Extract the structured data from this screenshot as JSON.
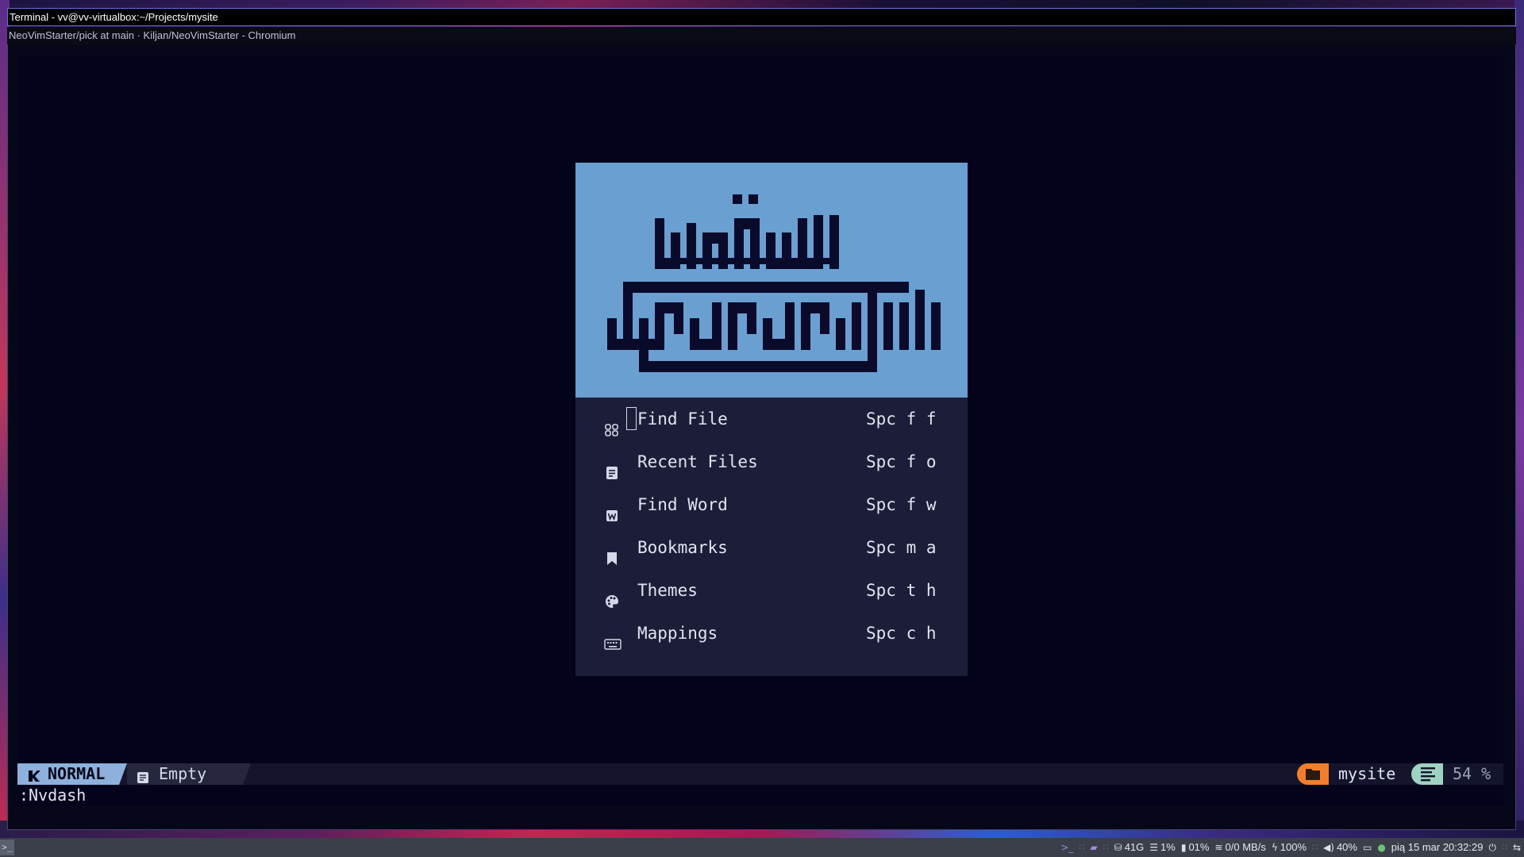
{
  "window": {
    "title": "Terminal - vv@vv-virtualbox:~/Projects/mysite",
    "behind_title": "NeoVimStarter/pick at main · Kiljan/NeoVimStarter - Chromium"
  },
  "dashboard": {
    "items": [
      {
        "icon": "find-file-icon",
        "label": "Find File",
        "key": "Spc f f"
      },
      {
        "icon": "recent-files-icon",
        "label": "Recent Files",
        "key": "Spc f o"
      },
      {
        "icon": "find-word-icon",
        "label": "Find Word",
        "key": "Spc f w"
      },
      {
        "icon": "bookmark-icon",
        "label": "Bookmarks",
        "key": "Spc m a"
      },
      {
        "icon": "palette-icon",
        "label": "Themes",
        "key": "Spc t h"
      },
      {
        "icon": "keyboard-icon",
        "label": "Mappings",
        "key": "Spc c h"
      }
    ]
  },
  "statusline": {
    "mode": "NORMAL",
    "file": "Empty",
    "cwd": "mysite",
    "percent": "54 %"
  },
  "cmdline": ":Nvdash",
  "panel": {
    "launcher": ">_",
    "disk": "41G",
    "cpu": "1%",
    "mem": "01%",
    "net": "0/0 MB/s",
    "battery": "100%",
    "volume": "40%",
    "datetime": "pią 15 mar 20:32:29"
  },
  "colors": {
    "header_bg": "#6a9fd2",
    "logo": "#0a0a2a",
    "list_bg": "#1c1d38",
    "mode_bg": "#8db1dc",
    "cwd_accent": "#f37e2a",
    "percent_accent": "#9ed3c2"
  }
}
